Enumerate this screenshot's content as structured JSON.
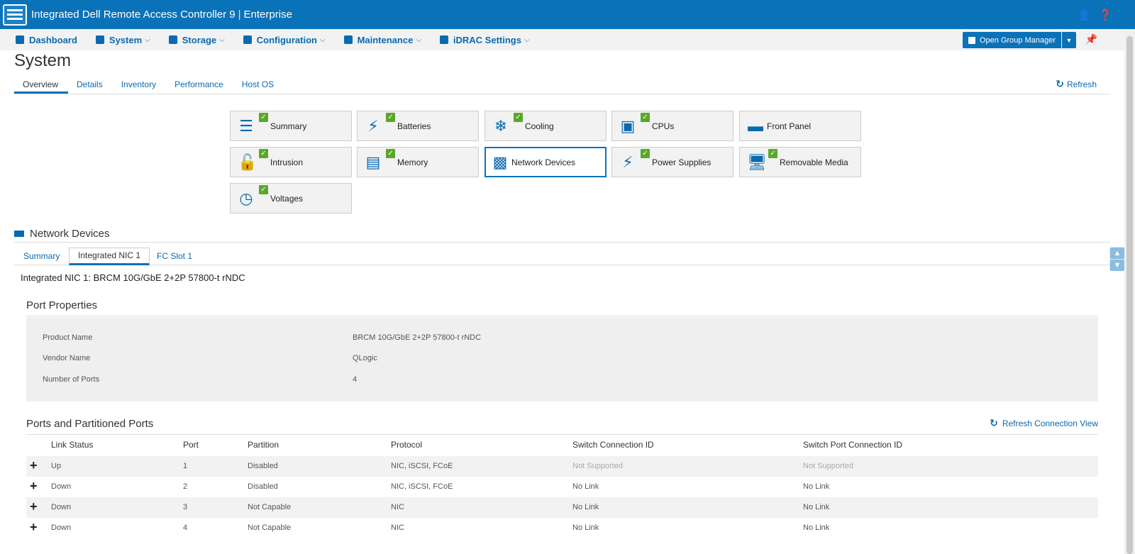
{
  "header": {
    "title": "Integrated Dell Remote Access Controller 9",
    "edition": "Enterprise",
    "user_icon": "user-icon",
    "help_icon": "help-icon"
  },
  "menu": [
    {
      "label": "Dashboard",
      "icon": "home-icon",
      "has_dropdown": false
    },
    {
      "label": "System",
      "icon": "server-icon",
      "has_dropdown": true
    },
    {
      "label": "Storage",
      "icon": "database-icon",
      "has_dropdown": true
    },
    {
      "label": "Configuration",
      "icon": "sliders-icon",
      "has_dropdown": true
    },
    {
      "label": "Maintenance",
      "icon": "wrench-icon",
      "has_dropdown": true
    },
    {
      "label": "iDRAC Settings",
      "icon": "gears-icon",
      "has_dropdown": true
    }
  ],
  "group_manager": {
    "label": "Open Group Manager"
  },
  "page": {
    "title": "System",
    "tabs": [
      "Overview",
      "Details",
      "Inventory",
      "Performance",
      "Host OS"
    ],
    "active_tab": "Overview",
    "refresh_label": "Refresh"
  },
  "tiles": [
    {
      "label": "Summary",
      "status": "ok",
      "icon": "list-icon"
    },
    {
      "label": "Batteries",
      "status": "ok",
      "icon": "battery-icon"
    },
    {
      "label": "Cooling",
      "status": "ok",
      "icon": "snowflake-icon"
    },
    {
      "label": "CPUs",
      "status": "ok",
      "icon": "cpu-icon"
    },
    {
      "label": "Front Panel",
      "status": "",
      "icon": "front-panel-icon"
    },
    {
      "label": "Intrusion",
      "status": "ok",
      "icon": "lock-icon"
    },
    {
      "label": "Memory",
      "status": "ok",
      "icon": "memory-icon"
    },
    {
      "label": "Network Devices",
      "status": "",
      "icon": "network-card-icon",
      "selected": true
    },
    {
      "label": "Power Supplies",
      "status": "ok",
      "icon": "plug-icon"
    },
    {
      "label": "Removable Media",
      "status": "ok",
      "icon": "monitor-icon"
    },
    {
      "label": "Voltages",
      "status": "ok",
      "icon": "gauge-icon"
    }
  ],
  "network_devices": {
    "title": "Network Devices",
    "subtabs": [
      "Summary",
      "Integrated NIC 1",
      "FC Slot 1"
    ],
    "active_subtab": "Integrated NIC 1",
    "nic_title": "Integrated NIC 1: BRCM 10G/GbE 2+2P 57800-t rNDC"
  },
  "port_properties": {
    "title": "Port Properties",
    "rows": [
      {
        "label": "Product Name",
        "value": "BRCM 10G/GbE 2+2P 57800-t rNDC"
      },
      {
        "label": "Vendor Name",
        "value": "QLogic"
      },
      {
        "label": "Number of Ports",
        "value": "4"
      }
    ]
  },
  "ports": {
    "title": "Ports and Partitioned Ports",
    "refresh_label": "Refresh Connection View",
    "columns": [
      "Link Status",
      "Port",
      "Partition",
      "Protocol",
      "Switch Connection ID",
      "Switch Port Connection ID"
    ],
    "rows": [
      [
        "Up",
        "1",
        "Disabled",
        "NIC, iSCSI, FCoE",
        "Not Supported",
        "Not Supported"
      ],
      [
        "Down",
        "2",
        "Disabled",
        "NIC, iSCSI, FCoE",
        "No Link",
        "No Link"
      ],
      [
        "Down",
        "3",
        "Not Capable",
        "NIC",
        "No Link",
        "No Link"
      ],
      [
        "Down",
        "4",
        "Not Capable",
        "NIC",
        "No Link",
        "No Link"
      ]
    ]
  }
}
